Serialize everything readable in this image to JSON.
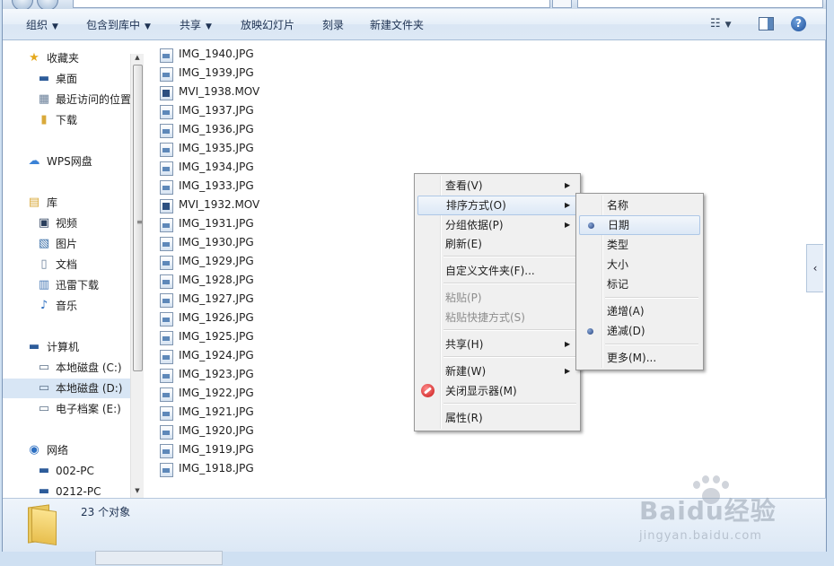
{
  "toolbar": {
    "items": [
      "组织",
      "包含到库中",
      "共享",
      "放映幻灯片",
      "刻录",
      "新建文件夹"
    ]
  },
  "sidebar": {
    "favorites": {
      "header": "收藏夹",
      "items": [
        "桌面",
        "最近访问的位置",
        "下载"
      ]
    },
    "wps": "WPS网盘",
    "libraries": {
      "header": "库",
      "items": [
        "视频",
        "图片",
        "文档",
        "迅雷下载",
        "音乐"
      ]
    },
    "computer": {
      "header": "计算机",
      "items": [
        "本地磁盘 (C:)",
        "本地磁盘 (D:)",
        "电子档案 (E:)"
      ]
    },
    "network": {
      "header": "网络",
      "items": [
        "002-PC",
        "0212-PC"
      ]
    }
  },
  "files": [
    "IMG_1940.JPG",
    "IMG_1939.JPG",
    "MVI_1938.MOV",
    "IMG_1937.JPG",
    "IMG_1936.JPG",
    "IMG_1935.JPG",
    "IMG_1934.JPG",
    "IMG_1933.JPG",
    "MVI_1932.MOV",
    "IMG_1931.JPG",
    "IMG_1930.JPG",
    "IMG_1929.JPG",
    "IMG_1928.JPG",
    "IMG_1927.JPG",
    "IMG_1926.JPG",
    "IMG_1925.JPG",
    "IMG_1924.JPG",
    "IMG_1923.JPG",
    "IMG_1922.JPG",
    "IMG_1921.JPG",
    "IMG_1920.JPG",
    "IMG_1919.JPG",
    "IMG_1918.JPG"
  ],
  "status": {
    "count": "23 个对象"
  },
  "context_menu": {
    "view": "查看(V)",
    "sort_by": "排序方式(O)",
    "group_by": "分组依据(P)",
    "refresh": "刷新(E)",
    "customize": "自定义文件夹(F)...",
    "paste": "粘贴(P)",
    "paste_shortcut": "粘贴快捷方式(S)",
    "share": "共享(H)",
    "new": "新建(W)",
    "close_display": "关闭显示器(M)",
    "properties": "属性(R)"
  },
  "sort_submenu": {
    "name": "名称",
    "date": "日期",
    "type": "类型",
    "size": "大小",
    "tags": "标记",
    "ascending": "递增(A)",
    "descending": "递减(D)",
    "more": "更多(M)...",
    "selected_field": "日期",
    "selected_order": "递减(D)"
  },
  "watermark": {
    "line1": "Baidu经验",
    "line2": "jingyan.baidu.com"
  },
  "colors": {
    "accent": "#1d4f9a",
    "highlight": "#dce8f6",
    "folder": "#e8bf4e"
  }
}
